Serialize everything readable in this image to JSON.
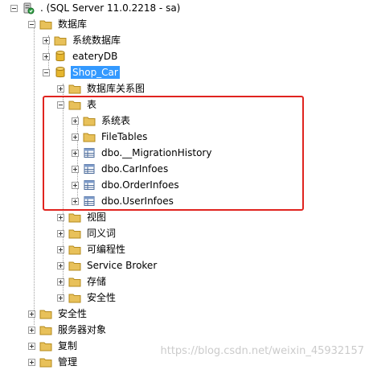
{
  "server": {
    "label": ". (SQL Server 11.0.2218 - sa)"
  },
  "databases": {
    "label": "数据库"
  },
  "system_databases": {
    "label": "系统数据库"
  },
  "eatery_db": {
    "label": "eateryDB"
  },
  "shop_car": {
    "label": "Shop_Car"
  },
  "db_diagrams": {
    "label": "数据库关系图"
  },
  "tables": {
    "label": "表"
  },
  "system_tables": {
    "label": "系统表"
  },
  "file_tables": {
    "label": "FileTables"
  },
  "table_items": [
    {
      "label": "dbo.__MigrationHistory"
    },
    {
      "label": "dbo.CarInfoes"
    },
    {
      "label": "dbo.OrderInfoes"
    },
    {
      "label": "dbo.UserInfoes"
    }
  ],
  "views": {
    "label": "视图"
  },
  "synonyms": {
    "label": "同义词"
  },
  "programmability": {
    "label": "可编程性"
  },
  "service_broker": {
    "label": "Service Broker"
  },
  "storage": {
    "label": "存储"
  },
  "db_security": {
    "label": "安全性"
  },
  "security": {
    "label": "安全性"
  },
  "server_objects": {
    "label": "服务器对象"
  },
  "replication": {
    "label": "复制"
  },
  "management": {
    "label": "管理"
  },
  "watermark": {
    "text": "https://blog.csdn.net/weixin_45932157"
  },
  "colors": {
    "selection": "#3399ff",
    "highlight_box": "#e0241f",
    "folder": "#e8c15a",
    "database": "#e6b62f"
  }
}
